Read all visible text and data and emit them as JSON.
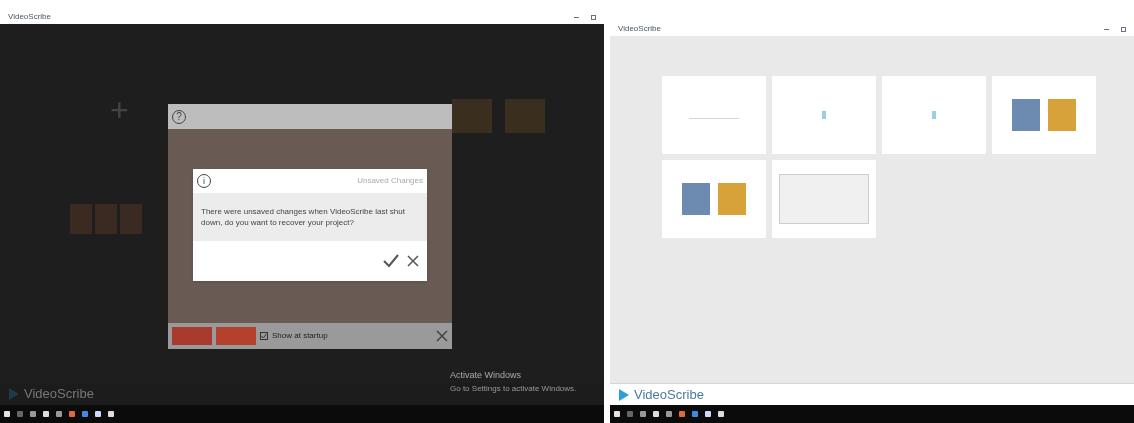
{
  "left_window": {
    "title": "VideoScribe",
    "new_project_symbol": "+",
    "help_panel": {
      "help_symbol": "?",
      "show_at_startup": {
        "label": "Show at startup",
        "checked": true
      }
    },
    "dialog": {
      "info_symbol": "i",
      "title": "Unsaved Changes",
      "message": "There were unsaved changes when VideoScribe last shut down, do you want to recover your project?"
    },
    "activation": {
      "title": "Activate Windows",
      "subtitle": "Go to Settings to activate Windows."
    },
    "logo": "VideoScribe"
  },
  "right_window": {
    "title": "VideoScribe",
    "cards": [
      {
        "kind": "logo"
      },
      {
        "kind": "blank"
      },
      {
        "kind": "blank"
      },
      {
        "kind": "collage"
      },
      {
        "kind": "collage"
      },
      {
        "kind": "sketch"
      }
    ],
    "logo": "VideoScribe"
  }
}
